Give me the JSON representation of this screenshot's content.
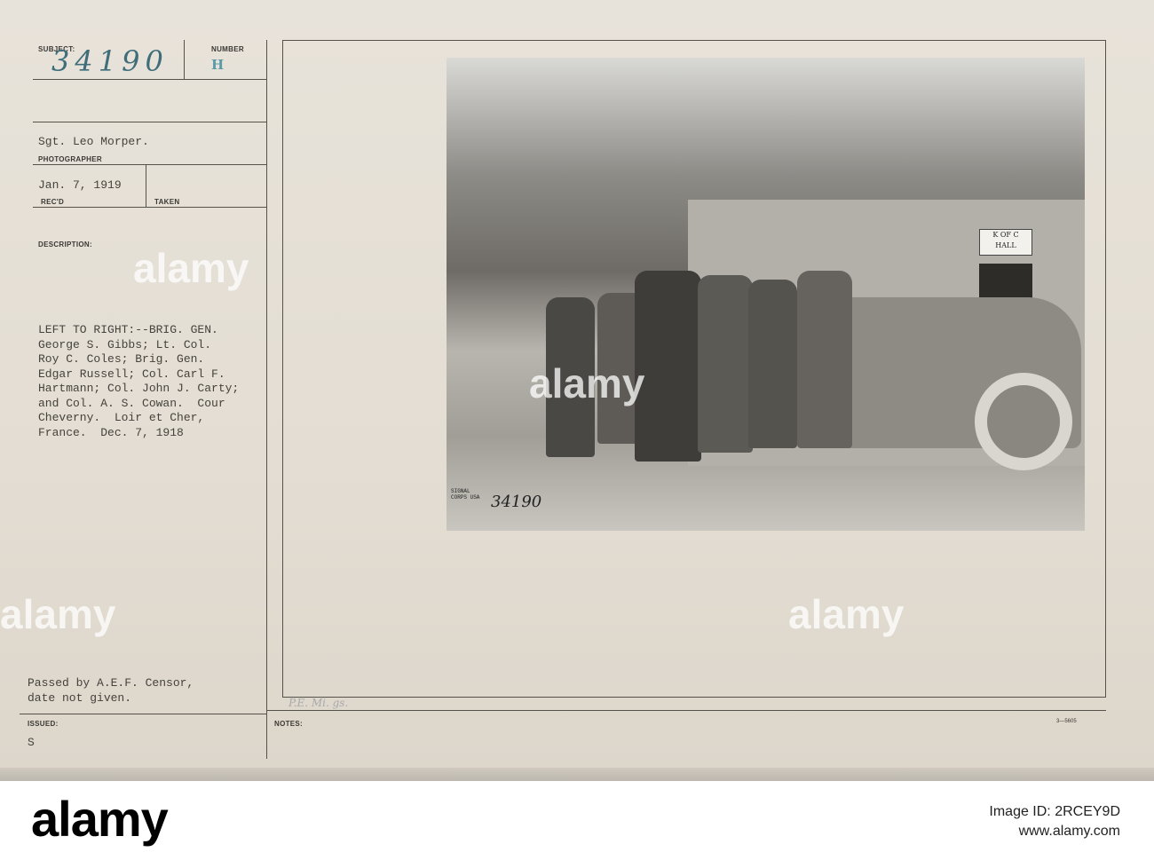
{
  "card": {
    "subject_label": "SUBJECT:",
    "subject_value": "34190",
    "number_label": "NUMBER",
    "number_value": "H",
    "photographer": "Sgt. Leo Morper.",
    "photographer_label": "PHOTOGRAPHER",
    "received": "Jan. 7, 1919",
    "received_label": "REC'D",
    "taken_label": "TAKEN",
    "description_label": "DESCRIPTION:",
    "description": "LEFT TO RIGHT:--BRIG. GEN.\nGeorge S. Gibbs; Lt. Col.\nRoy C. Coles; Brig. Gen.\nEdgar Russell; Col. Carl F.\nHartmann; Col. John J. Carty;\nand Col. A. S. Cowan.  Cour\nCheverny.  Loir et Cher,\nFrance.  Dec. 7, 1918",
    "censor": "Passed by A.E.F. Censor,\ndate not given.",
    "issued_label": "ISSUED:",
    "issued_value": "S",
    "notes_label": "NOTES:",
    "notes_handwritten": "P.E. Mi. gs.",
    "form_number": "3—5605"
  },
  "photo": {
    "sign": "K OF C\nHALL",
    "stamp": "SIGNAL CORPS USA",
    "number": "34190"
  },
  "watermark": "alamy",
  "banner": {
    "logo": "alamy",
    "image_id": "Image ID: 2RCEY9D",
    "url": "www.alamy.com"
  }
}
